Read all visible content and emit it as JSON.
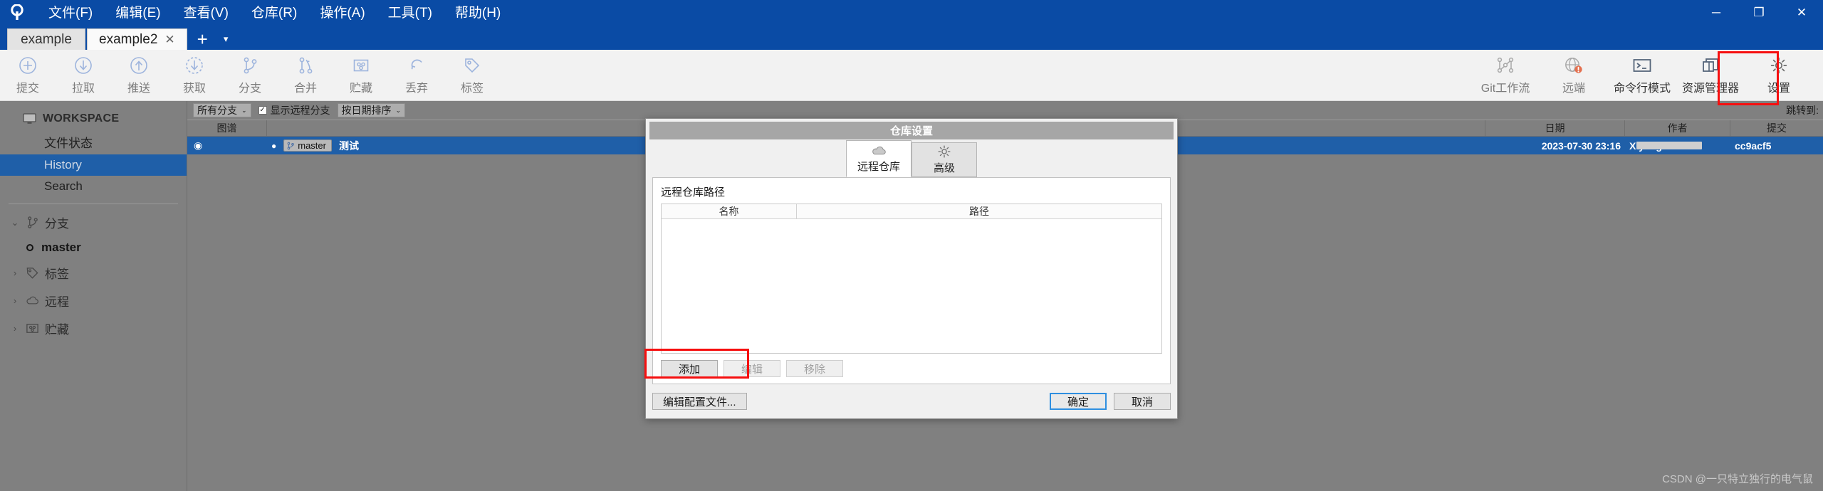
{
  "window": {
    "menus": [
      {
        "label": "文件(F)",
        "name": "menu-file"
      },
      {
        "label": "编辑(E)",
        "name": "menu-edit"
      },
      {
        "label": "查看(V)",
        "name": "menu-view"
      },
      {
        "label": "仓库(R)",
        "name": "menu-repository"
      },
      {
        "label": "操作(A)",
        "name": "menu-actions"
      },
      {
        "label": "工具(T)",
        "name": "menu-tools"
      },
      {
        "label": "帮助(H)",
        "name": "menu-help"
      }
    ],
    "controls": {
      "minimize": "─",
      "maximize": "❐",
      "close": "✕"
    }
  },
  "tabs": {
    "items": [
      {
        "label": "example",
        "active": false,
        "closable": false
      },
      {
        "label": "example2",
        "active": true,
        "closable": true
      }
    ],
    "close_glyph": "✕",
    "add_label": "+",
    "caret_label": "▾"
  },
  "toolbar": {
    "left": [
      {
        "label": "提交",
        "icon": "commit-icon",
        "enabled": false
      },
      {
        "label": "拉取",
        "icon": "pull-icon",
        "enabled": false
      },
      {
        "label": "推送",
        "icon": "push-icon",
        "enabled": false
      },
      {
        "label": "获取",
        "icon": "fetch-icon",
        "enabled": false
      },
      {
        "label": "分支",
        "icon": "branch-icon",
        "enabled": false
      },
      {
        "label": "合并",
        "icon": "merge-icon",
        "enabled": false
      },
      {
        "label": "贮藏",
        "icon": "stash-icon",
        "enabled": false
      },
      {
        "label": "丢弃",
        "icon": "discard-icon",
        "enabled": false
      },
      {
        "label": "标签",
        "icon": "tag-icon",
        "enabled": false
      }
    ],
    "right": [
      {
        "label": "Git工作流",
        "icon": "git-flow-icon",
        "enabled": false
      },
      {
        "label": "远端",
        "icon": "remote-globe-icon",
        "enabled": false,
        "badge": "!"
      },
      {
        "label": "命令行模式",
        "icon": "terminal-icon",
        "enabled": true
      },
      {
        "label": "资源管理器",
        "icon": "explorer-icon",
        "enabled": true
      },
      {
        "label": "设置",
        "icon": "gear-icon",
        "enabled": true
      }
    ]
  },
  "sidebar": {
    "workspace_label": "WORKSPACE",
    "workspace_items": [
      {
        "label": "文件状态",
        "selected": false
      },
      {
        "label": "History",
        "selected": true
      },
      {
        "label": "Search",
        "selected": false
      }
    ],
    "nodes": [
      {
        "label": "分支",
        "icon": "branch-icon",
        "expanded": true,
        "chevron": "⌄",
        "children": [
          {
            "label": "master",
            "icon": "branch-dot-icon"
          }
        ]
      },
      {
        "label": "标签",
        "icon": "tag-icon",
        "expanded": false,
        "chevron": "›",
        "children": []
      },
      {
        "label": "远程",
        "icon": "cloud-icon",
        "expanded": false,
        "chevron": "›",
        "children": []
      },
      {
        "label": "贮藏",
        "icon": "stash-icon",
        "expanded": false,
        "chevron": "›",
        "children": []
      }
    ]
  },
  "history": {
    "filters": {
      "branch_select": "所有分支",
      "show_remote_branches_label": "显示远程分支",
      "show_remote_branches_checked": true,
      "check_glyph": "✓",
      "sort_select": "按日期排序",
      "caret": "⌄",
      "jump_to_label": "跳转到:"
    },
    "columns": [
      "图谱",
      "",
      "日期",
      "作者",
      "提交"
    ],
    "rows": [
      {
        "graph": "◉",
        "branch_chip": "master",
        "message": "测试",
        "date": "2023-07-30 23:16",
        "author": "X          yang <1",
        "commit": "cc9acf5"
      }
    ]
  },
  "dialog": {
    "title": "仓库设置",
    "tabs": [
      {
        "label": "远程仓库",
        "icon": "cloud-icon",
        "active": true
      },
      {
        "label": "高级",
        "icon": "gear-icon",
        "active": false
      }
    ],
    "group_label": "远程仓库路径",
    "table": {
      "headers": [
        "名称",
        "路径"
      ],
      "rows": []
    },
    "list_buttons": [
      {
        "label": "添加",
        "enabled": true,
        "highlighted": true
      },
      {
        "label": "编辑",
        "enabled": false,
        "highlighted": false
      },
      {
        "label": "移除",
        "enabled": false,
        "highlighted": false
      }
    ],
    "footer_buttons": [
      {
        "label": "编辑配置文件...",
        "style": "normal"
      },
      {
        "label": "确定",
        "style": "primary"
      },
      {
        "label": "取消",
        "style": "normal"
      }
    ]
  },
  "watermark": "CSDN @一只特立独行的电气鼠",
  "colors": {
    "accent_blue": "#0a4ba5",
    "selection_blue": "#1f5fa8",
    "annotation_red": "#f60f0f",
    "sidebar_gray": "#808080",
    "toolbar_icon_blue": "#9db4dd"
  }
}
